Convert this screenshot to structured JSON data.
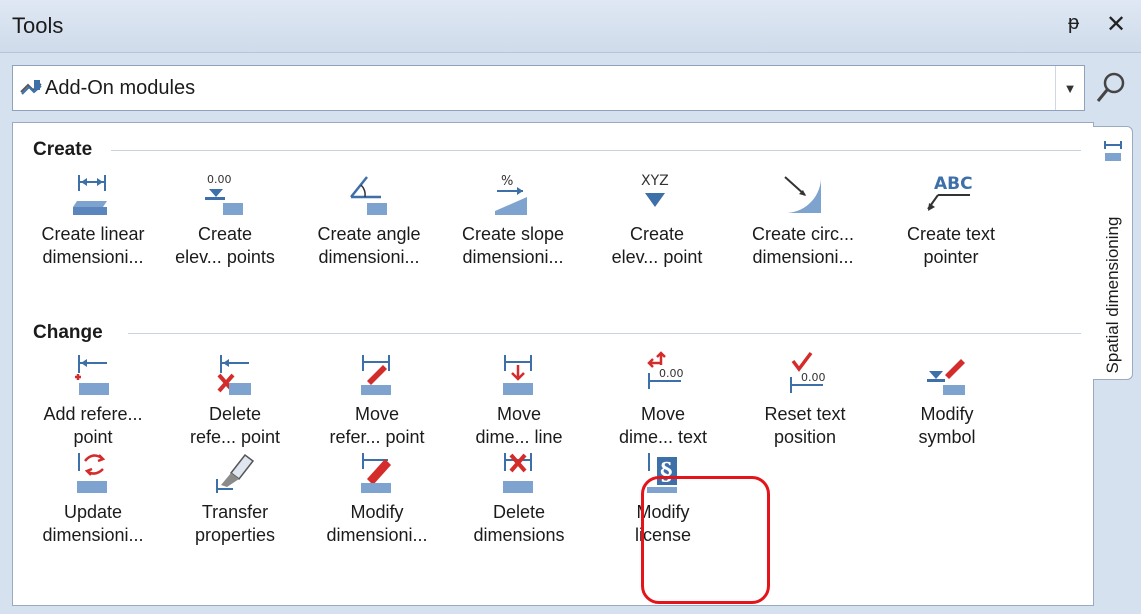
{
  "window": {
    "title": "Tools"
  },
  "titlebar": {
    "pin_icon": "pin-icon",
    "close_icon": "close-icon"
  },
  "combo": {
    "value": "Add-On modules",
    "icon": "add-on-modules-icon",
    "arrow_icon": "chevron-down-icon"
  },
  "search": {
    "icon": "search-icon"
  },
  "sidetab": {
    "label": "Spatial dimensioning"
  },
  "sections": {
    "create": {
      "title": "Create",
      "tools": [
        {
          "l1": "Create linear",
          "l2": "dimensioni..."
        },
        {
          "l1": "Create",
          "l2": "elev... points"
        },
        {
          "l1": "Create angle",
          "l2": "dimensioni..."
        },
        {
          "l1": "Create slope",
          "l2": "dimensioni..."
        },
        {
          "l1": "Create",
          "l2": "elev... point"
        },
        {
          "l1": "Create circ...",
          "l2": "dimensioni..."
        },
        {
          "l1": "Create text",
          "l2": "pointer"
        }
      ]
    },
    "change": {
      "title": "Change",
      "tools": [
        {
          "l1": "Add refere...",
          "l2": "point"
        },
        {
          "l1": "Delete",
          "l2": "refe... point"
        },
        {
          "l1": "Move",
          "l2": "refer... point"
        },
        {
          "l1": "Move",
          "l2": "dime... line"
        },
        {
          "l1": "Move",
          "l2": "dime... text"
        },
        {
          "l1": "Reset text",
          "l2": "position"
        },
        {
          "l1": "Modify",
          "l2": "symbol"
        },
        {
          "l1": "Update",
          "l2": "dimensioni..."
        },
        {
          "l1": "Transfer",
          "l2": "properties"
        },
        {
          "l1": "Modify",
          "l2": "dimensioni..."
        },
        {
          "l1": "Delete",
          "l2": "dimensions"
        },
        {
          "l1": "Modify",
          "l2": "license"
        }
      ]
    }
  },
  "icon_text": {
    "elev": "0.00",
    "slope": "%",
    "xyz": "XYZ",
    "abc": "ABC"
  },
  "colors": {
    "accent_red": "#e3151b",
    "icon_blue": "#3d6fa8",
    "icon_red": "#d42b2b"
  }
}
